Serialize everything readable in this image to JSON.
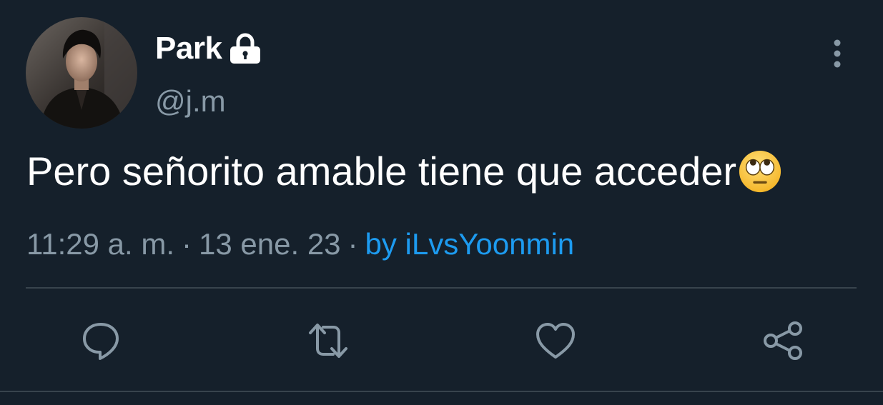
{
  "tweet": {
    "display_name": "Park",
    "handle": "@j.m",
    "text": "Pero señorito amable tiene que acceder",
    "emoji": "face-with-rolling-eyes",
    "time": "11:29 a. m.",
    "separator": "·",
    "date": "13 ene. 23",
    "source": "by iLvsYoonmin"
  },
  "icons": {
    "lock": "lock-icon",
    "more": "more-vertical-icon",
    "reply": "reply-icon",
    "retweet": "retweet-icon",
    "like": "heart-icon",
    "share": "share-icon"
  },
  "colors": {
    "background": "#15202b",
    "primary_text": "#ffffff",
    "secondary_text": "#8899a6",
    "link": "#1d9bf0",
    "divider": "#38444d"
  }
}
